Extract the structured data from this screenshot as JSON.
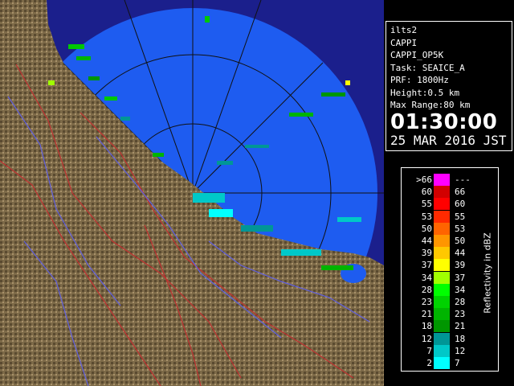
{
  "radar": {
    "site": "ilts2",
    "product": "CAPPI",
    "product_id": "CAPPI_OP5K",
    "task": "Task: SEAICE_A",
    "prf": "PRF: 1800Hz",
    "height": "Height:0.5 km",
    "max_range": "Max Range:80 km",
    "time": "01:30:00",
    "date": "25 MAR 2016 JST"
  },
  "legend": {
    "title": "Reflectivity in dBZ",
    "rows": [
      {
        "lo": ">66",
        "hi": "---",
        "color": "#ff00ff"
      },
      {
        "lo": "60",
        "hi": "66",
        "color": "#d20000"
      },
      {
        "lo": "55",
        "hi": "60",
        "color": "#ff0000"
      },
      {
        "lo": "53",
        "hi": "55",
        "color": "#ff2a00"
      },
      {
        "lo": "50",
        "hi": "53",
        "color": "#ff6400"
      },
      {
        "lo": "44",
        "hi": "50",
        "color": "#ff9600"
      },
      {
        "lo": "39",
        "hi": "44",
        "color": "#ffc800"
      },
      {
        "lo": "37",
        "hi": "39",
        "color": "#ffff00"
      },
      {
        "lo": "34",
        "hi": "37",
        "color": "#a0ff00"
      },
      {
        "lo": "28",
        "hi": "34",
        "color": "#00ff00"
      },
      {
        "lo": "23",
        "hi": "28",
        "color": "#00d200"
      },
      {
        "lo": "21",
        "hi": "23",
        "color": "#00b400"
      },
      {
        "lo": "18",
        "hi": "21",
        "color": "#009600"
      },
      {
        "lo": "12",
        "hi": "18",
        "color": "#009696"
      },
      {
        "lo": "7",
        "hi": "12",
        "color": "#00c8c8"
      },
      {
        "lo": "2",
        "hi": "7",
        "color": "#00ffff"
      }
    ]
  },
  "colors": {
    "radar_disc": "#1e5cf0",
    "outside": "#1b1f8c",
    "land": "#7d6a48",
    "rivers": "#6060e0",
    "borders": "#c03030",
    "range_rings": "#111111"
  }
}
